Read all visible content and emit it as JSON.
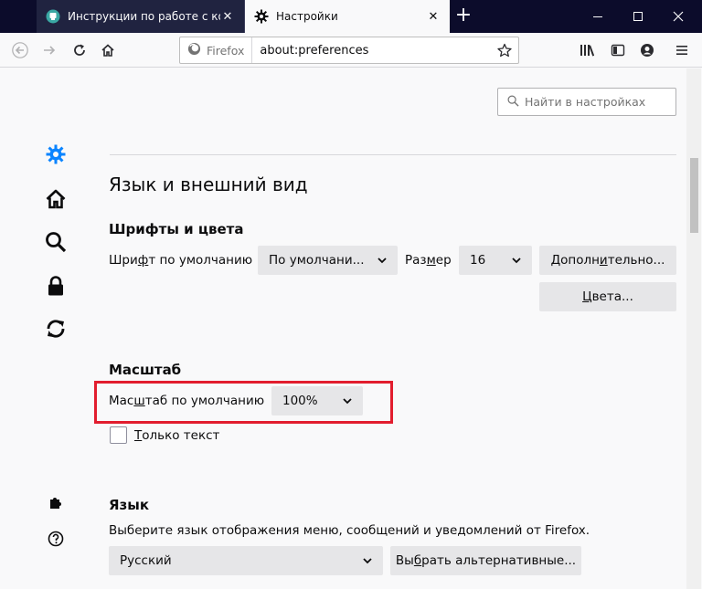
{
  "tabs": [
    {
      "title": "Инструкции по работе с комп",
      "state": "inactive"
    },
    {
      "title": "Настройки",
      "state": "active"
    }
  ],
  "toolbar": {
    "identity_label": "Firefox",
    "url": "about:preferences"
  },
  "search": {
    "placeholder": "Найти в настройках"
  },
  "section_title": "Язык и внешний вид",
  "fonts": {
    "heading": "Шрифты и цвета",
    "default_font_label_pre": "Шри",
    "default_font_label_accel": "ф",
    "default_font_label_post": "т по умолчанию",
    "font_value": "По умолчани...",
    "size_label_pre": "Раз",
    "size_label_accel": "м",
    "size_label_post": "ер",
    "size_value": "16",
    "advanced_pre": "Дополн",
    "advanced_accel": "и",
    "advanced_post": "тельно...",
    "colors_pre": "",
    "colors_accel": "Ц",
    "colors_post": "вета..."
  },
  "zoom": {
    "heading": "Масштаб",
    "default_zoom_label_pre": "Мас",
    "default_zoom_label_accel": "ш",
    "default_zoom_label_post": "таб по умолчанию",
    "zoom_value": "100%",
    "text_only_pre": "",
    "text_only_accel": "Т",
    "text_only_post": "олько текст"
  },
  "language": {
    "heading": "Язык",
    "description": "Выберите язык отображения меню, сообщений и уведомлений от Firefox.",
    "language_value": "Русский",
    "alternatives_pre": "Вы",
    "alternatives_accel": "б",
    "alternatives_post": "рать альтернативные..."
  },
  "colors": {
    "accent_icon": "#0a84ff",
    "highlight_border": "#e21d2e",
    "titlebar": "#0c0c2b"
  },
  "icons": {
    "general": "gear-icon",
    "home": "home-icon",
    "search": "magnifier-icon",
    "privacy": "lock-icon",
    "sync": "sync-icon",
    "extensions": "puzzle-icon",
    "support": "help-icon"
  }
}
